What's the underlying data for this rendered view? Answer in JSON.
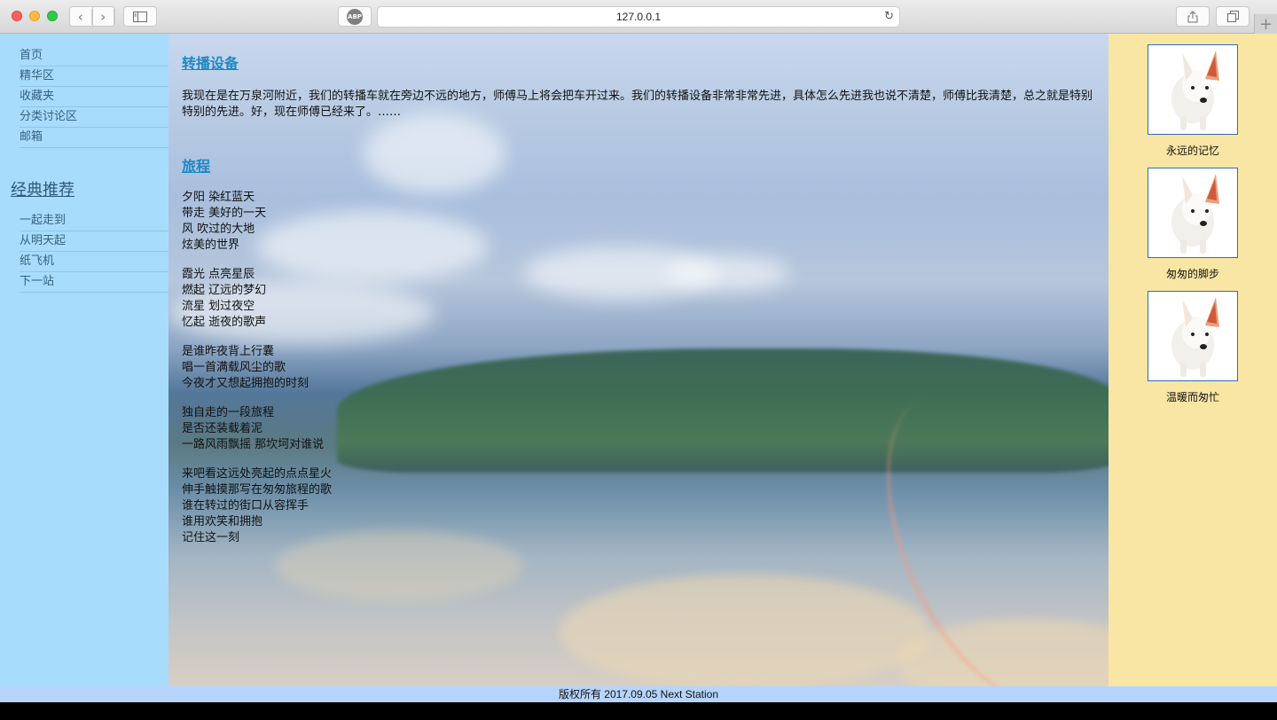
{
  "browser": {
    "url": "127.0.0.1",
    "adblock_label": "ABP"
  },
  "sidebar": {
    "nav": [
      "首页",
      "精华区",
      "收藏夹",
      "分类讨论区",
      "邮箱"
    ],
    "recommend_title": "经典推荐",
    "recommend": [
      "一起走到",
      "从明天起",
      "纸飞机",
      "下一站"
    ]
  },
  "main": {
    "section1_title": "转播设备",
    "section1_text": "我现在是在万泉河附近，我们的转播车就在旁边不远的地方，师傅马上将会把车开过来。我们的转播设备非常非常先进，具体怎么先进我也说不清楚，师傅比我清楚，总之就是特别特别的先进。好，现在师傅已经来了。……",
    "section2_title": "旅程",
    "stanzas": [
      [
        "夕阳 染红蓝天",
        "带走 美好的一天",
        "风 吹过的大地",
        "炫美的世界"
      ],
      [
        "霞光 点亮星辰",
        "燃起 辽远的梦幻",
        "流星 划过夜空",
        "忆起 逝夜的歌声"
      ],
      [
        "是谁昨夜背上行囊",
        "唱一首满载风尘的歌",
        "今夜才又想起拥抱的时刻"
      ],
      [
        "独自走的一段旅程",
        "是否还装载着泥",
        "一路风雨飘摇 那坎坷对谁说"
      ],
      [
        "来吧看这远处亮起的点点星火",
        "伸手触摸那写在匆匆旅程的歌",
        "谁在转过的街口从容挥手",
        "谁用欢笑和拥抱",
        "记住这一刻"
      ]
    ]
  },
  "right": {
    "cards": [
      {
        "caption": "永远的记忆"
      },
      {
        "caption": "匆匆的脚步"
      },
      {
        "caption": "温暖而匆忙"
      }
    ]
  },
  "footer": {
    "text": "版权所有 2017.09.05 Next Station"
  }
}
